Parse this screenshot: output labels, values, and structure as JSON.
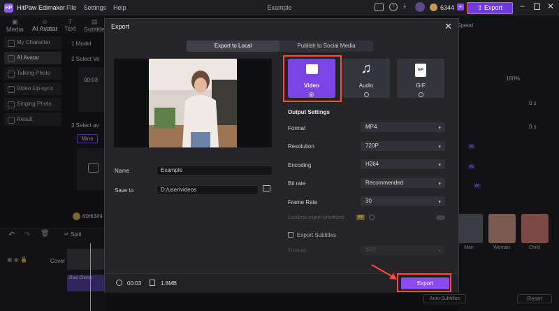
{
  "app": {
    "name": "HitPaw Edimakor",
    "menu": [
      "File",
      "Settings",
      "Help"
    ],
    "window_title": "Example",
    "coins": "6344",
    "export_label": "Export"
  },
  "tabs": [
    "Media",
    "AI Avatar",
    "Text",
    "Subtitle"
  ],
  "nav": [
    "My Character",
    "AI Avatar",
    "Talking Photo",
    "Video Lip-sync",
    "Singing Photo",
    "Result"
  ],
  "bg": {
    "model": "1 Model",
    "select_voice": "2 Select Vo",
    "voice_time": "00:03",
    "select_avatar": "3 Select av",
    "mine": "Mine",
    "credits": "60/6344",
    "split": "Split",
    "cover": "Cover",
    "speed": "Speed",
    "percent": "100%",
    "val1": "0",
    "unit1": "s",
    "val2": "0",
    "unit2": "s",
    "ai": "AI",
    "people": [
      "Man",
      "Woman",
      "Child"
    ],
    "auto_subtitles": "Auto Subtitles",
    "reset": "Reset",
    "clip": "Zhao Cheng"
  },
  "dialog": {
    "title": "Export",
    "tabs": [
      "Export to Local",
      "Publish to Social Media"
    ],
    "name_label": "Name",
    "name_value": "Example",
    "save_label": "Save to",
    "save_value": "D:/user/videos",
    "types": [
      "Video",
      "Audio",
      "GIF"
    ],
    "output_settings": "Output Settings",
    "rows": [
      {
        "label": "Format",
        "value": "MP4"
      },
      {
        "label": "Resolution",
        "value": "720P"
      },
      {
        "label": "Encoding",
        "value": "H264"
      },
      {
        "label": "Bit rate",
        "value": "Recommended"
      },
      {
        "label": "Frame Rate",
        "value": "30"
      }
    ],
    "lossless": "Lossless export prioritized",
    "vip": "VIP",
    "export_subtitles": "Export Subtitles",
    "sub_format_label": "Format",
    "sub_format_value": "SRT",
    "duration": "00:03",
    "size": "1.8MB",
    "export_button": "Export"
  }
}
